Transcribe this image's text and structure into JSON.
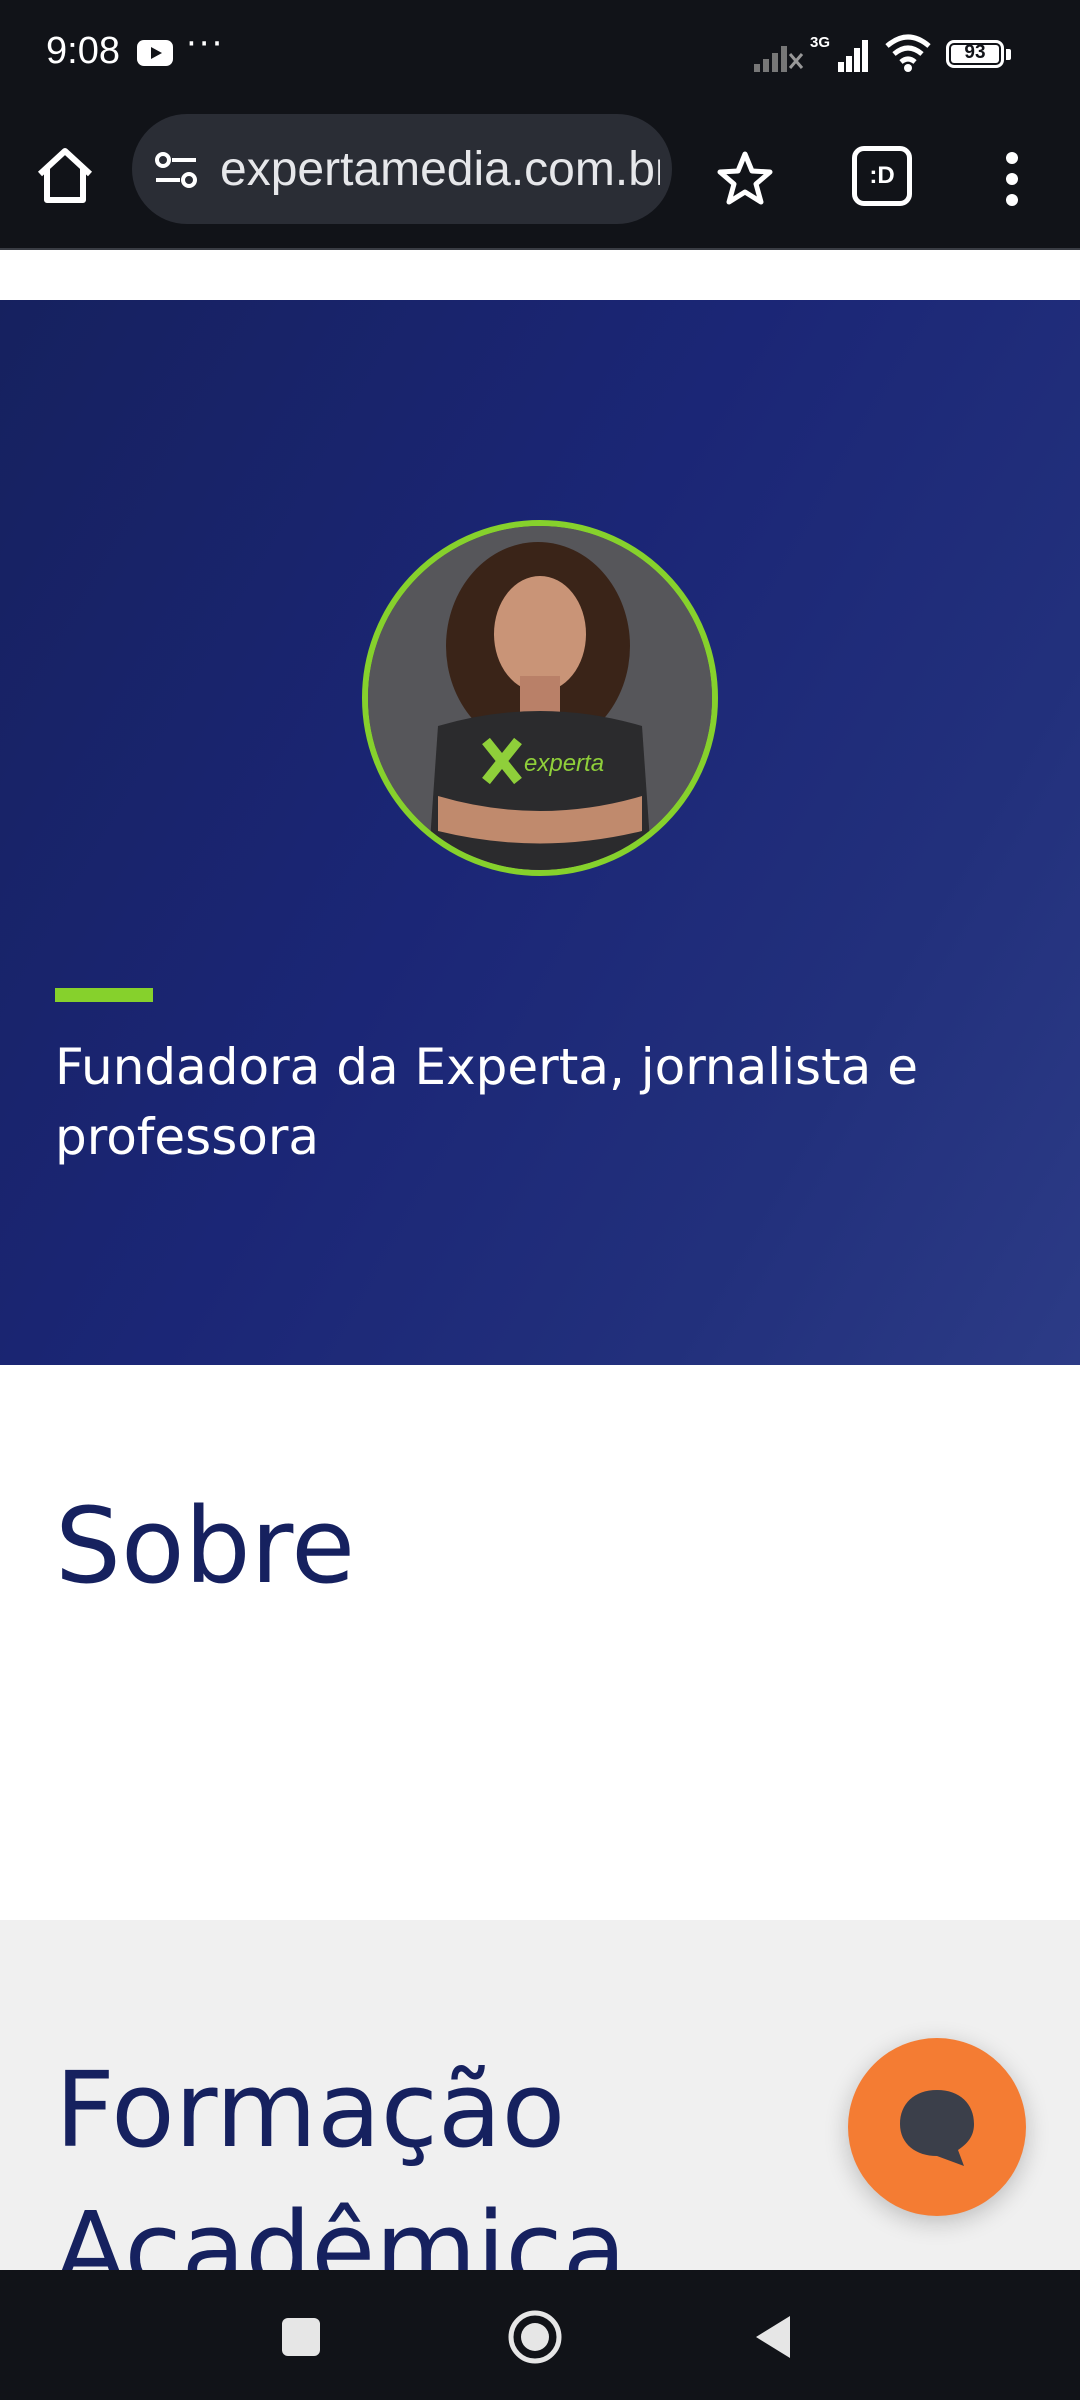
{
  "status_bar": {
    "time": "9:08",
    "icons": [
      "youtube-icon",
      "more-dots-icon",
      "signal-x-icon",
      "signal-3g-icon",
      "wifi-icon",
      "battery-icon"
    ],
    "more": "···",
    "network_label": "3G",
    "battery_level": "93"
  },
  "browser": {
    "url": "expertamedia.com.br",
    "tabs_label": ":D"
  },
  "hero": {
    "subtitle": "Fundadora da Experta, jornalista e professora",
    "accent_color": "#86d12c",
    "background_color": "#1b2676"
  },
  "sobre": {
    "title": "Sobre"
  },
  "formacao": {
    "title": "Formação Acadêmica"
  },
  "chat": {
    "fab_color": "#f47c33"
  },
  "colors": {
    "heading": "#16215f",
    "accent": "#86d12c",
    "fab": "#f47c33"
  }
}
